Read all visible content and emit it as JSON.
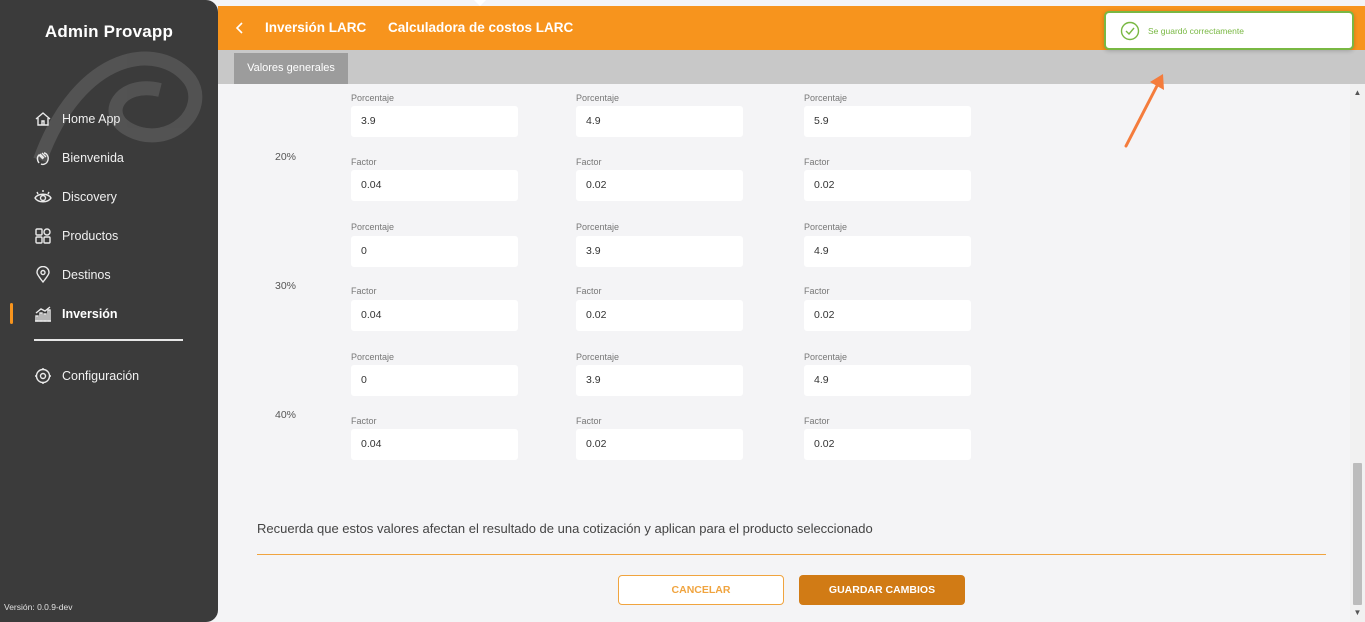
{
  "sidebar": {
    "brand": "Admin Provapp",
    "items": [
      {
        "label": "Home App",
        "icon": "home-icon"
      },
      {
        "label": "Bienvenida",
        "icon": "waving-hand-icon"
      },
      {
        "label": "Discovery",
        "icon": "eye-icon"
      },
      {
        "label": "Productos",
        "icon": "grid-icon"
      },
      {
        "label": "Destinos",
        "icon": "location-pin-icon"
      },
      {
        "label": "Inversión",
        "icon": "bar-chart-icon",
        "active": true
      }
    ],
    "config": {
      "label": "Configuración",
      "icon": "gear-icon"
    },
    "version": "Versión: 0.0.9-dev"
  },
  "header": {
    "back_icon": "chevron-left-icon",
    "crumb1": "Inversión LARC",
    "crumb2": "Calculadora de costos LARC",
    "accent": "#f7941d"
  },
  "tabs": {
    "active": "Valores generales"
  },
  "toast": {
    "message": "Se guardó correctamente",
    "icon": "check-circle-icon",
    "color": "#79b843"
  },
  "groups": [
    {
      "label": "20%",
      "porcentaje_label": "Porcentaje",
      "factor_label": "Factor",
      "porcentaje": [
        "3.9",
        "4.9",
        "5.9"
      ],
      "factor": [
        "0.04",
        "0.02",
        "0.02"
      ]
    },
    {
      "label": "30%",
      "porcentaje_label": "Porcentaje",
      "factor_label": "Factor",
      "porcentaje": [
        "0",
        "3.9",
        "4.9"
      ],
      "factor": [
        "0.04",
        "0.02",
        "0.02"
      ]
    },
    {
      "label": "40%",
      "porcentaje_label": "Porcentaje",
      "factor_label": "Factor",
      "porcentaje": [
        "0",
        "3.9",
        "4.9"
      ],
      "factor": [
        "0.04",
        "0.02",
        "0.02"
      ]
    }
  ],
  "note": "Recuerda que estos valores afectan el resultado de una cotización y aplican para el producto seleccionado",
  "buttons": {
    "cancel": "CANCELAR",
    "save": "GUARDAR CAMBIOS"
  }
}
